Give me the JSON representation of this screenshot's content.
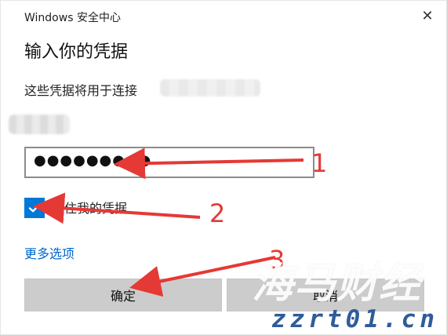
{
  "window": {
    "title": "Windows 安全中心",
    "close_symbol": "✕"
  },
  "dialog": {
    "heading": "输入你的凭据",
    "connect_text": "这些凭据将用于连接",
    "password_mask": "●●●●●●●●●",
    "checkbox_label": "记住我的凭据",
    "more_options": "更多选项",
    "ok_label": "确定",
    "cancel_label": "取消"
  },
  "annotations": {
    "one": "1",
    "two": "2",
    "three": "3"
  },
  "watermark": {
    "main": "海马财经",
    "site": "zzrt01.cn"
  },
  "colors": {
    "accent": "#0078d7",
    "link": "#0066cc",
    "arrow": "#e53935"
  },
  "icons": {
    "close": "close-icon",
    "checkbox": "check-icon"
  },
  "checkbox": {
    "checked": true
  }
}
